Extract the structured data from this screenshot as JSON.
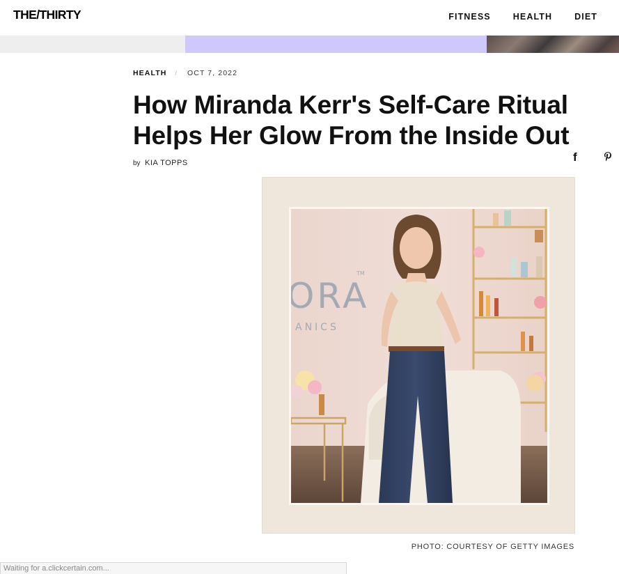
{
  "header": {
    "logo": "THE/THIRTY",
    "nav": [
      "FITNESS",
      "HEALTH",
      "DIET"
    ]
  },
  "article": {
    "category": "HEALTH",
    "separator": "/",
    "date": "OCT 7, 2022",
    "title": "How Miranda Kerr's Self-Care Ritual Helps Her Glow From the Inside Out",
    "byline_prefix": "by",
    "author": "KIA TOPPS",
    "share": {
      "facebook_glyph": "f"
    },
    "photo_caption": "PHOTO: COURTESY OF GETTY IMAGES",
    "photo_backdrop": {
      "text_top": "ORA",
      "tm": "TM",
      "text_bottom": "ANICS"
    }
  },
  "status_bar": {
    "text": "Waiting for a.clickcertain.com..."
  },
  "colors": {
    "ad_lavender": "#cfc8fa",
    "ad_gray": "#eeeeee",
    "frame_beige": "#efe6dc"
  },
  "icons": [
    "facebook-icon",
    "pinterest-icon"
  ]
}
